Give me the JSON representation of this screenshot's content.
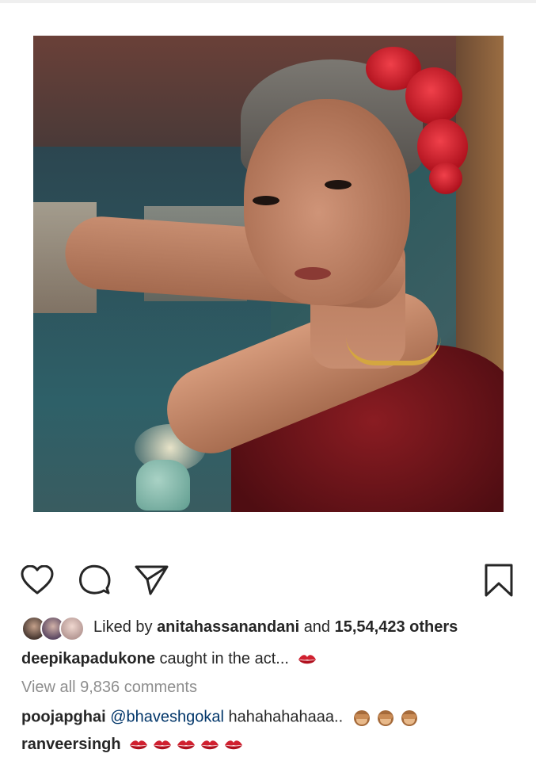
{
  "post": {
    "image_alt": "Photo of a woman with red roses in her hair adjusting her hair",
    "icons": {
      "like": "heart-icon",
      "comment": "comment-bubble-icon",
      "share": "paper-plane-icon",
      "save": "bookmark-icon"
    },
    "likes": {
      "prefix": "Liked by",
      "user": "anitahassanandani",
      "connector": "and",
      "count_text": "15,54,423 others"
    },
    "caption": {
      "username": "deepikapadukone",
      "text": "caught in the act..."
    },
    "view_comments": "View all 9,836 comments",
    "comments": [
      {
        "username": "poojapghai",
        "mention": "@bhaveshgokal",
        "text": "hahahahahaaa.."
      },
      {
        "username": "ranveersingh"
      }
    ]
  },
  "colors": {
    "text": "#262626",
    "muted": "#8e8e8e",
    "mention": "#003569",
    "lips_emoji": "#d0202f"
  }
}
